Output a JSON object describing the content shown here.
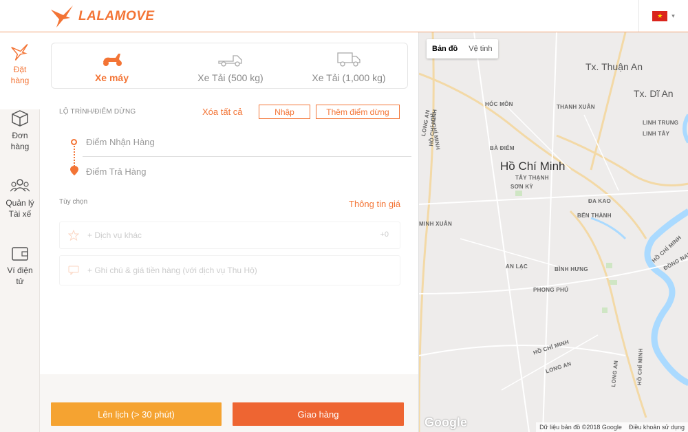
{
  "header": {
    "logo_text": "LALAMOVE",
    "language_flag": "vietnam-flag-icon",
    "language_caret": "chevron-down-icon"
  },
  "sidebar": {
    "items": [
      {
        "label_line1": "Đặt",
        "label_line2": "hàng",
        "icon": "bird-logo-icon",
        "active": true
      },
      {
        "label_line1": "Đơn",
        "label_line2": "hàng",
        "icon": "box-icon",
        "active": false
      },
      {
        "label_line1": "Quản lý",
        "label_line2": "Tài xế",
        "icon": "drivers-icon",
        "active": false
      },
      {
        "label_line1": "Ví điện",
        "label_line2": "tử",
        "icon": "wallet-icon",
        "active": false
      }
    ]
  },
  "vehicles": [
    {
      "label": "Xe máy",
      "icon": "scooter-icon",
      "active": true
    },
    {
      "label": "Xe Tải (500 kg)",
      "icon": "pickup-truck-icon",
      "active": false
    },
    {
      "label": "Xe Tải (1,000 kg)",
      "icon": "van-truck-icon",
      "active": false
    }
  ],
  "route": {
    "section_label": "LỘ TRÌNH/ĐIỂM DỪNG",
    "clear_all": "Xóa tất cả",
    "import_button": "Nhập",
    "add_stop_button": "Thêm điểm dừng",
    "pickup_placeholder": "Điểm Nhận Hàng",
    "dropoff_placeholder": "Điểm Trả Hàng"
  },
  "options": {
    "section_label": "Tùy chọn",
    "price_info": "Thông tin giá",
    "other_services": "+ Dịch vụ khác",
    "other_services_count": "+0",
    "notes": "+ Ghi chú & giá tiền hàng (với dịch vụ Thu Hộ)"
  },
  "actions": {
    "schedule_button": "Lên lịch (> 30 phút)",
    "deliver_button": "Giao hàng",
    "schedule_color": "#f5a331",
    "deliver_color": "#ee6532"
  },
  "map": {
    "toggle_map": "Bản đồ",
    "toggle_satellite": "Vệ tinh",
    "labels": {
      "tx_thuan_an": "Tx. Thuận An",
      "tx_di_an": "Tx. Dĩ An",
      "hoc_mon": "HÓC MÔN",
      "thanh_xuan": "THANH XUÂN",
      "linh_trung": "LINH TRUNG",
      "linh_tay": "LINH TÂY",
      "ba_diem": "BÀ ĐIỂM",
      "ho_chi_minh": "Hồ Chí Minh",
      "tay_thanh": "TÂY THẠNH",
      "son_ky": "SƠN KỲ",
      "da_kao": "ĐA KAO",
      "ben_thanh": "BẾN THÀNH",
      "minh_xuan": "MINH XUÂN",
      "an_lac": "AN LẠC",
      "binh_hung": "BÌNH HƯNG",
      "phong_phu": "PHONG PHÚ",
      "long_an_1": "LONG AN",
      "long_an_2": "LONG AN",
      "long_an_3": "LONG AN",
      "ho_chi_minh_road_1": "HỒ CHÍ MINH",
      "ho_chi_minh_road_2": "HỒ CHÍ MINH",
      "ho_chi_minh_road_3": "HỒ CHÍ MINH",
      "ho_chi_minh_road_4": "HỒ CHÍ MINH",
      "ho_chi_minh_road_5": "HỒ CHÍ MINH",
      "dong_nai": "ĐỒNG NAI"
    },
    "google_logo": "Google",
    "attribution": "Dữ liệu bản đồ ©2018 Google",
    "terms": "Điều khoản sử dụng"
  }
}
